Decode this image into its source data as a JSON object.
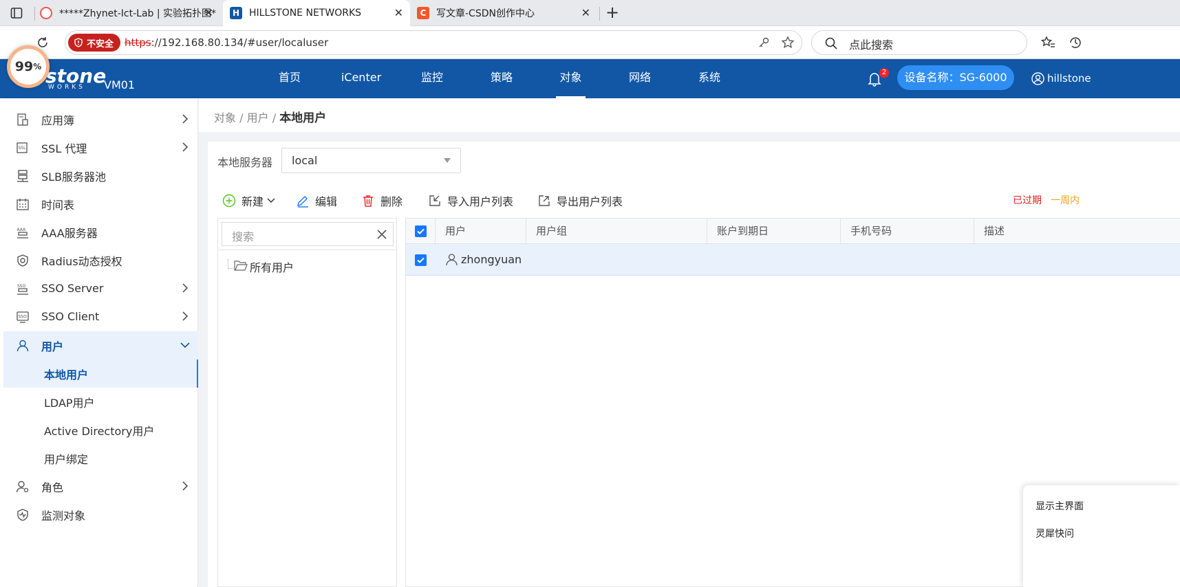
{
  "browser": {
    "tabs": [
      {
        "title": "*****Zhynet-Ict-Lab | 实验拓扑图*",
        "active": false
      },
      {
        "title": "HILLSTONE NETWORKS",
        "active": true
      },
      {
        "title": "写文章-CSDN创作中心",
        "active": false
      }
    ],
    "insecure_label": "不安全",
    "url_scheme": "https",
    "url_rest": "://192.168.80.134/#user/localuser",
    "search_placeholder": "点此搜索",
    "zoom_badge": "99",
    "zoom_unit": "%"
  },
  "header": {
    "logo_text": "stone",
    "logo_sub": "WORKS",
    "device": "VM01",
    "nav": [
      "首页",
      "iCenter",
      "监控",
      "策略",
      "对象",
      "网络",
      "系统"
    ],
    "active_nav": 4,
    "notif_count": "2",
    "device_name": "设备名称：SG-6000",
    "user": "hillstone"
  },
  "sidebar": {
    "items": [
      {
        "label": "应用簿",
        "icon": "app-book-icon",
        "chevron": "right"
      },
      {
        "label": "SSL 代理",
        "icon": "ssl-proxy-icon",
        "chevron": "right"
      },
      {
        "label": "SLB服务器池",
        "icon": "server-pool-icon",
        "chevron": ""
      },
      {
        "label": "时间表",
        "icon": "calendar-icon",
        "chevron": ""
      },
      {
        "label": "AAA服务器",
        "icon": "aaa-server-icon",
        "chevron": ""
      },
      {
        "label": "Radius动态授权",
        "icon": "shield-icon",
        "chevron": ""
      },
      {
        "label": "SSO Server",
        "icon": "sso-server-icon",
        "chevron": "right"
      },
      {
        "label": "SSO Client",
        "icon": "sso-client-icon",
        "chevron": "right"
      },
      {
        "label": "用户",
        "icon": "user-icon",
        "chevron": "down"
      },
      {
        "label": "本地用户",
        "sub": true
      },
      {
        "label": "LDAP用户",
        "sub": true
      },
      {
        "label": "Active Directory用户",
        "sub": true
      },
      {
        "label": "用户绑定",
        "sub": true
      },
      {
        "label": "角色",
        "icon": "role-icon",
        "chevron": "right"
      },
      {
        "label": "监测对象",
        "icon": "monitor-object-icon",
        "chevron": ""
      }
    ]
  },
  "breadcrumb": {
    "part1": "对象",
    "sep": "/",
    "part2": "用户",
    "current": "本地用户"
  },
  "server": {
    "label": "本地服务器",
    "value": "local"
  },
  "toolbar": {
    "new_label": "新建",
    "edit_label": "编辑",
    "delete_label": "删除",
    "import_label": "导入用户列表",
    "export_label": "导出用户列表",
    "expired_label": "已过期",
    "week_label": "一周内"
  },
  "tree": {
    "search_placeholder": "搜索",
    "root": "所有用户"
  },
  "table": {
    "columns": [
      "用户",
      "用户组",
      "账户到期日",
      "手机号码",
      "描述"
    ],
    "rows": [
      {
        "user": "zhongyuan",
        "group": "",
        "expire": "",
        "phone": "",
        "desc": ""
      }
    ]
  },
  "float_panel": {
    "line1": "显示主界面",
    "line2": "灵犀快问"
  },
  "colors": {
    "header": "#1157a6",
    "accent": "#1677ff",
    "insecure": "#c5221f",
    "expired": "#e02020",
    "week": "#f0a020"
  }
}
